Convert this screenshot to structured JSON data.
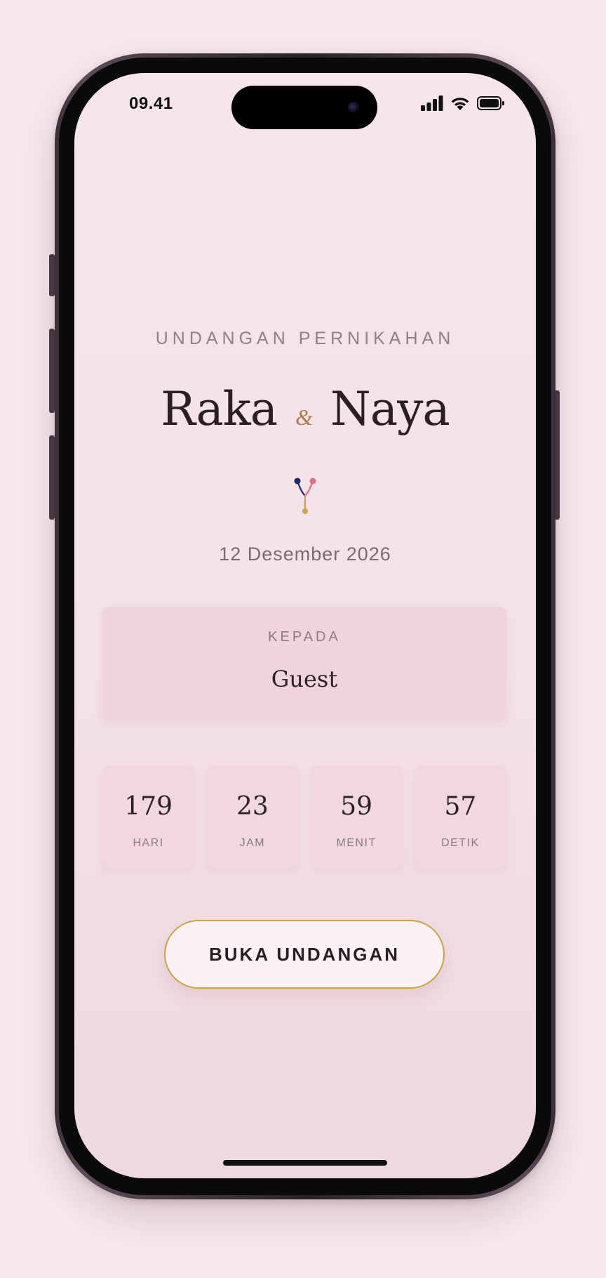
{
  "status_bar": {
    "time": "09.41"
  },
  "invitation": {
    "eyebrow": "UNDANGAN PERNIKAHAN",
    "groom": "Raka",
    "ampersand": "&",
    "bride": "Naya",
    "date": "12 Desember 2026"
  },
  "guest": {
    "label": "KEPADA",
    "name": "Guest"
  },
  "countdown": [
    {
      "value": "179",
      "label": "HARI"
    },
    {
      "value": "23",
      "label": "JAM"
    },
    {
      "value": "59",
      "label": "MENIT"
    },
    {
      "value": "57",
      "label": "DETIK"
    }
  ],
  "open_button": {
    "label": "BUKA UNDANGAN"
  },
  "colors": {
    "page_background": "#f6e8ec",
    "card_background": "#f0d4dc",
    "button_border": "#c9a24a",
    "ornament_navy": "#1e2a6b",
    "ornament_pink": "#e0708a",
    "ornament_gold": "#c9a24a"
  },
  "icons": {
    "signal": "cellular-signal-icon",
    "wifi": "wifi-icon",
    "battery": "battery-icon",
    "ornament": "ornament-icon"
  }
}
